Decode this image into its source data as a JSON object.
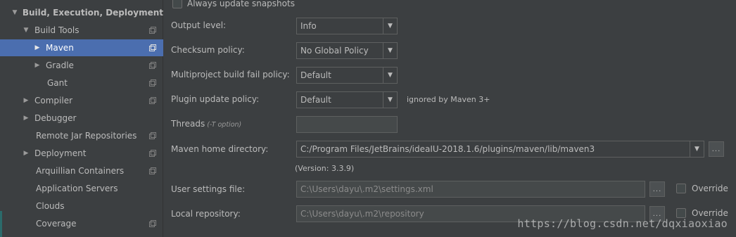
{
  "sidebar": {
    "section_title": "Build, Execution, Deployment",
    "items": [
      {
        "label": "Build Tools",
        "arrow": "▼"
      },
      {
        "label": "Maven",
        "arrow": "▶"
      },
      {
        "label": "Gradle",
        "arrow": "▶"
      },
      {
        "label": "Gant",
        "arrow": ""
      },
      {
        "label": "Compiler",
        "arrow": "▶"
      },
      {
        "label": "Debugger",
        "arrow": "▶"
      },
      {
        "label": "Remote Jar Repositories",
        "arrow": ""
      },
      {
        "label": "Deployment",
        "arrow": "▶"
      },
      {
        "label": "Arquillian Containers",
        "arrow": ""
      },
      {
        "label": "Application Servers",
        "arrow": ""
      },
      {
        "label": "Clouds",
        "arrow": ""
      },
      {
        "label": "Coverage",
        "arrow": ""
      }
    ],
    "section_arrow": "▼",
    "selected_item": "Maven"
  },
  "main": {
    "always_update_snapshots": "Always update snapshots",
    "output_level": {
      "label": "Output level:",
      "value": "Info"
    },
    "checksum_policy": {
      "label": "Checksum policy:",
      "value": "No Global Policy"
    },
    "multiproject_fail_policy": {
      "label": "Multiproject build fail policy:",
      "value": "Default"
    },
    "plugin_update_policy": {
      "label": "Plugin update policy:",
      "value": "Default",
      "note": "ignored by Maven 3+"
    },
    "threads": {
      "label": "Threads",
      "hint": "(-T option)",
      "value": ""
    },
    "maven_home": {
      "label": "Maven home directory:",
      "value": "C:/Program Files/JetBrains/ideaIU-2018.1.6/plugins/maven/lib/maven3",
      "version": "(Version: 3.3.9)"
    },
    "user_settings": {
      "label": "User settings file:",
      "value": "C:\\Users\\dayu\\.m2\\settings.xml",
      "override": "Override"
    },
    "local_repository": {
      "label": "Local repository:",
      "value": "C:\\Users\\dayu\\.m2\\repository",
      "override": "Override"
    },
    "browse_label": "...",
    "dropdown_glyph": "▼"
  },
  "watermark": "https://blog.csdn.net/dqxiaoxiao"
}
